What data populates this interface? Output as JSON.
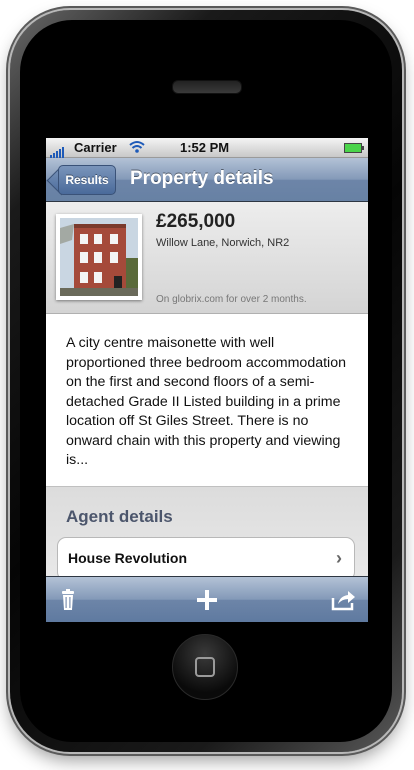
{
  "status_bar": {
    "carrier": "Carrier",
    "time": "1:52 PM"
  },
  "nav": {
    "back_label": "Results",
    "title": "Property details"
  },
  "listing": {
    "price": "£265,000",
    "address": "Willow Lane, Norwich, NR2",
    "listed_note": "On globrix.com for over 2 months.",
    "photo": "property-photo"
  },
  "description": "A city centre maisonette with well proportioned three bedroom accommodation on the first and second floors of a semi-detached Grade II Listed building in a prime location off St Giles Street. There is no onward chain with this property and viewing is...",
  "agent": {
    "heading": "Agent details",
    "name": "House Revolution",
    "chevron": "›"
  },
  "toolbar": {
    "icons": [
      "trash-icon",
      "add-icon",
      "share-icon"
    ]
  },
  "colors": {
    "nav_bar": "#6d85a8",
    "agent_heading": "#4c566c",
    "battery": "#4ad44a"
  }
}
